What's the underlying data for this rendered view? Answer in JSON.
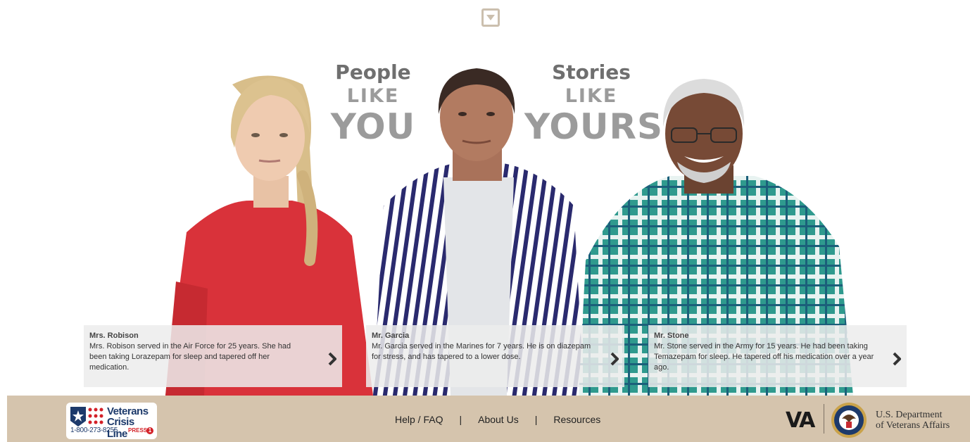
{
  "headline": {
    "left": {
      "line1": "People",
      "line2": "LIKE",
      "line3": "YOU"
    },
    "right": {
      "line1": "Stories",
      "line2": "LIKE",
      "line3": "YOURS"
    }
  },
  "stories": [
    {
      "name": "Mrs. Robison",
      "text": "Mrs. Robison served in the Air Force for 25 years. She had been taking Lorazepam for sleep and tapered off her medication."
    },
    {
      "name": "Mr. Garcia",
      "text": "Mr. Garcia served in the Marines for 7 years. He is on diazepam for stress, and has tapered to a lower dose."
    },
    {
      "name": "Mr. Stone",
      "text": "Mr. Stone served in the Army for 15 years. He had been taking Temazepam for sleep. He tapered off his medication over a year ago."
    }
  ],
  "crisis_line": {
    "line1": "Veterans",
    "line2": "Crisis Line",
    "phone": "1-800-273-8255",
    "press": "PRESS",
    "press_number": "1"
  },
  "nav": {
    "help": "Help / FAQ",
    "about": "About Us",
    "resources": "Resources",
    "separator": "|"
  },
  "va": {
    "logo": "VA",
    "dept_line1": "U.S. Department",
    "dept_line2": "of Veterans Affairs"
  },
  "colors": {
    "footer_bg": "#d5c4ad",
    "story_bg": "#ececec",
    "va_blue": "#1d3a6b",
    "crisis_red": "#d32027"
  }
}
